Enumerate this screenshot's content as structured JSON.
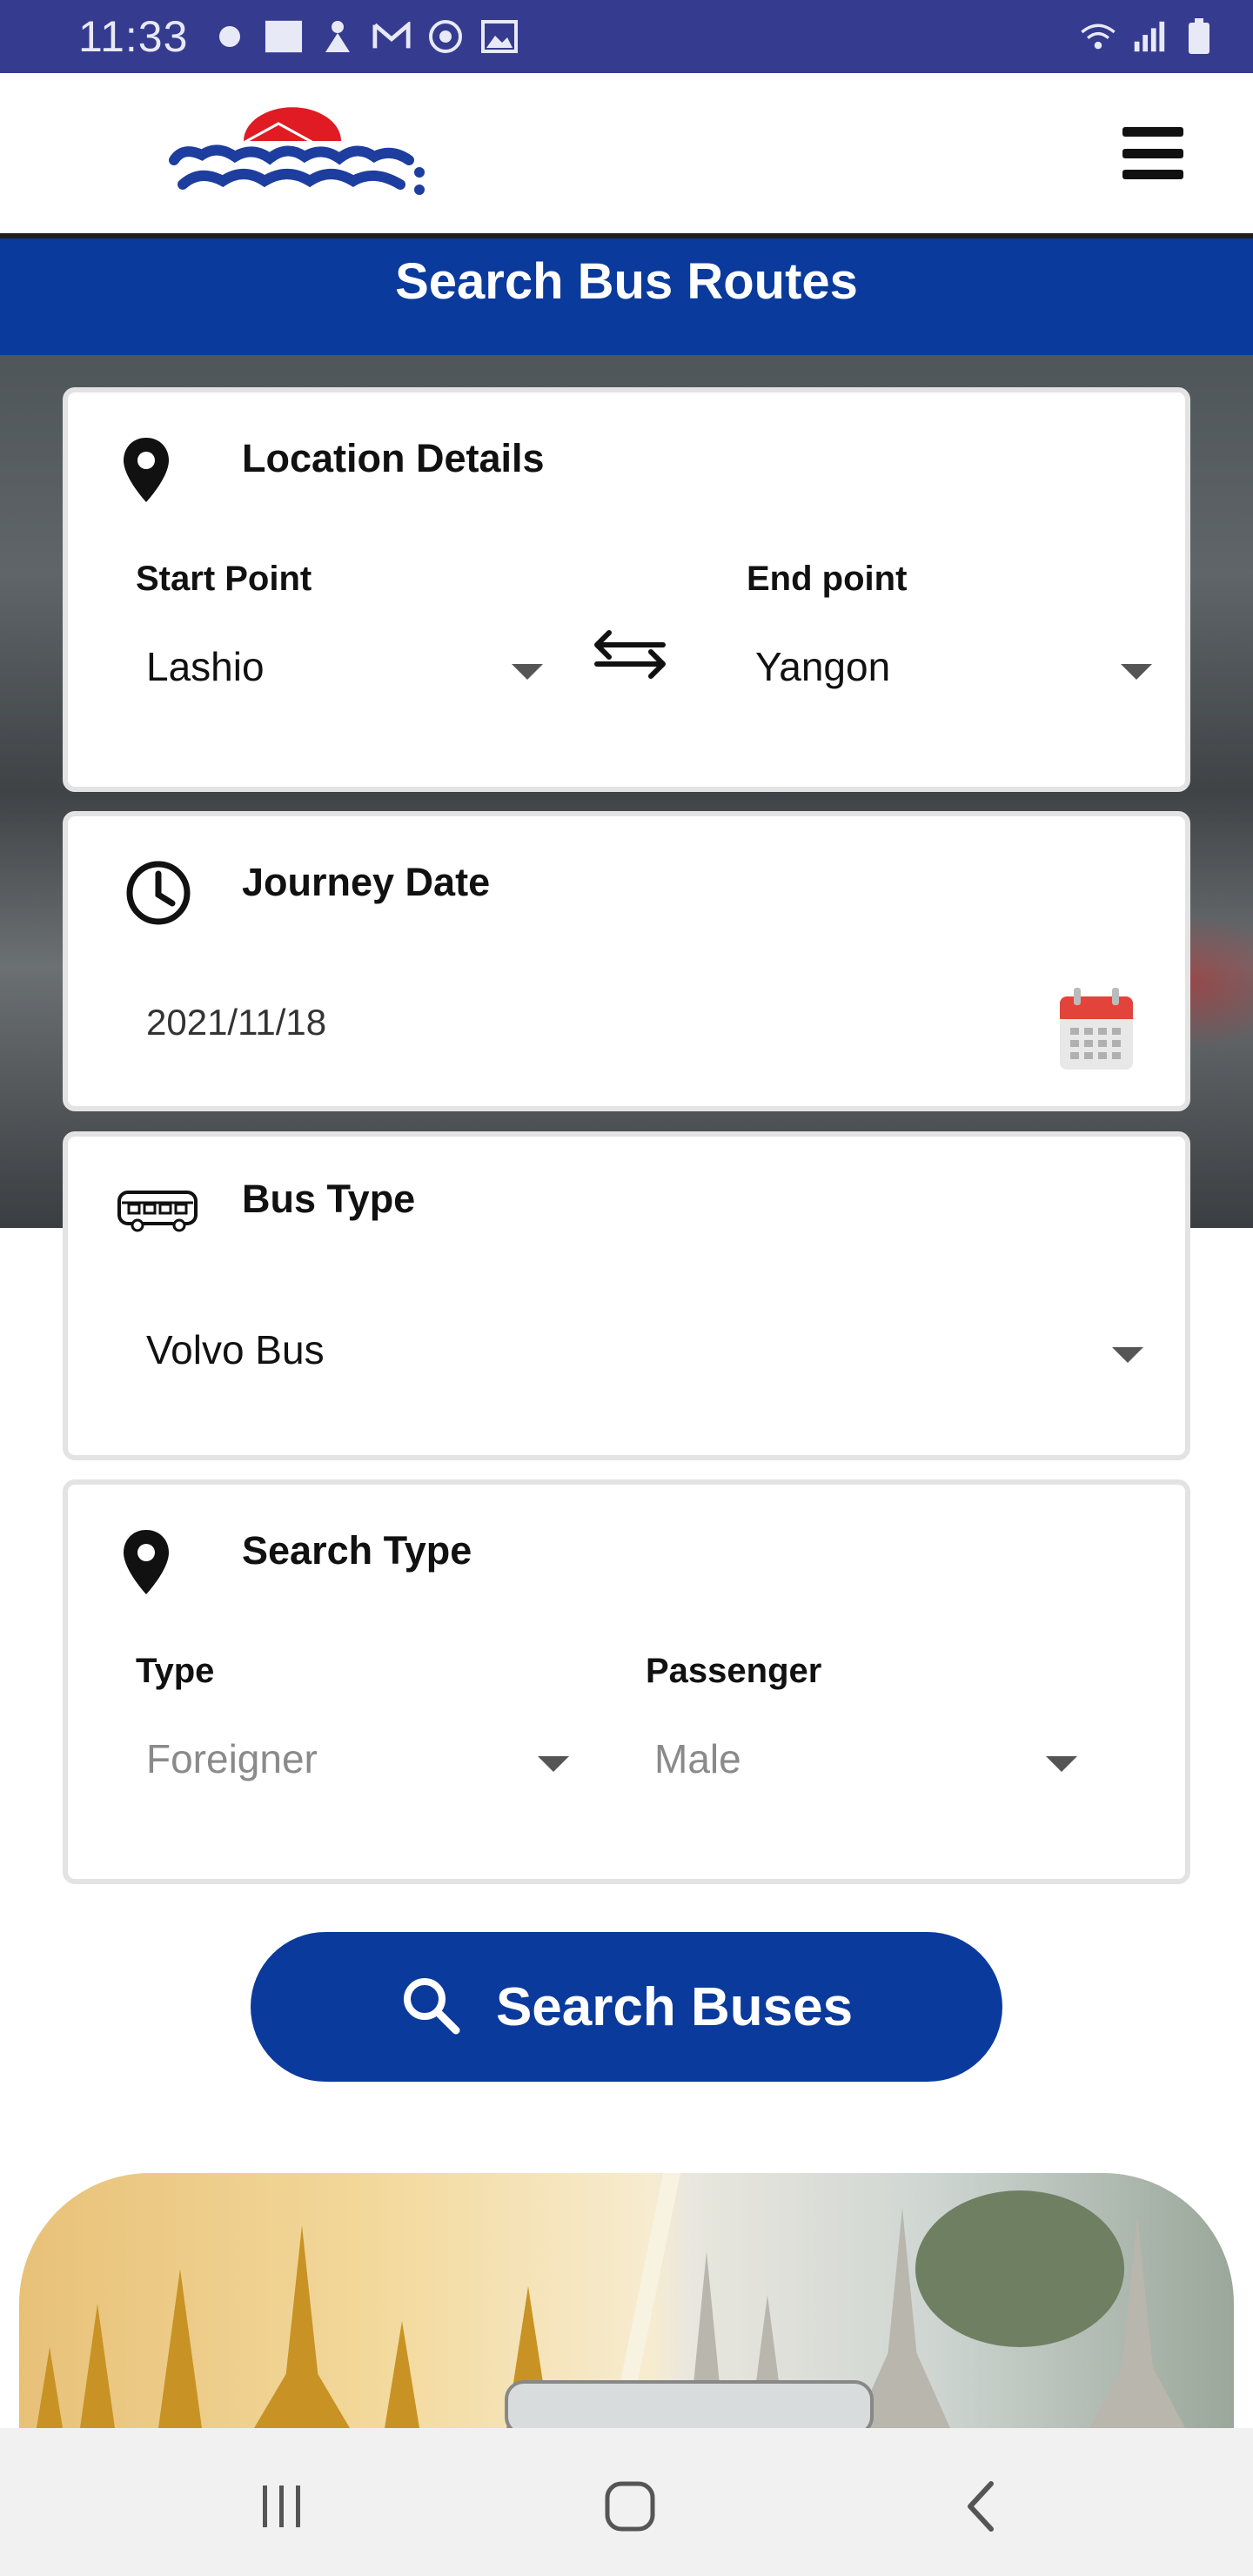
{
  "status_bar": {
    "time": "11:33"
  },
  "header": {
    "title": "Search Bus Routes"
  },
  "location_card": {
    "title": "Location Details",
    "start_label": "Start Point",
    "start_value": "Lashio",
    "end_label": "End point",
    "end_value": "Yangon"
  },
  "date_card": {
    "title": "Journey Date",
    "date_value": "2021/11/18"
  },
  "bus_card": {
    "title": "Bus Type",
    "bus_value": "Volvo Bus"
  },
  "search_type_card": {
    "title": "Search Type",
    "type_label": "Type",
    "type_value": "Foreigner",
    "passenger_label": "Passenger",
    "passenger_value": "Male"
  },
  "search_button": {
    "label": "Search Buses"
  },
  "colors": {
    "primary": "#0a3a9c",
    "status_bar": "#353b8f"
  }
}
